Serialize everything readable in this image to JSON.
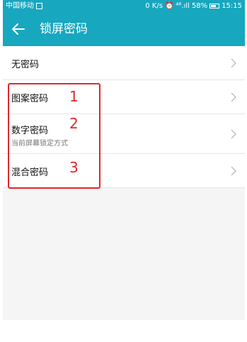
{
  "status_bar": {
    "carrier": "中国移动",
    "speed": "0 K/s",
    "signal": "⁴⁶.ıll",
    "battery": "58%",
    "time": "15:15"
  },
  "app_bar": {
    "title": "锁屏密码"
  },
  "options": [
    {
      "label": "无密码"
    },
    {
      "label": "图案密码"
    },
    {
      "label": "数字密码",
      "sub": "当前屏幕锁定方式"
    },
    {
      "label": "混合密码"
    }
  ],
  "annotations": [
    "1",
    "2",
    "3"
  ],
  "colors": {
    "accent": "#17a7bf",
    "annotation": "#e0272b"
  }
}
